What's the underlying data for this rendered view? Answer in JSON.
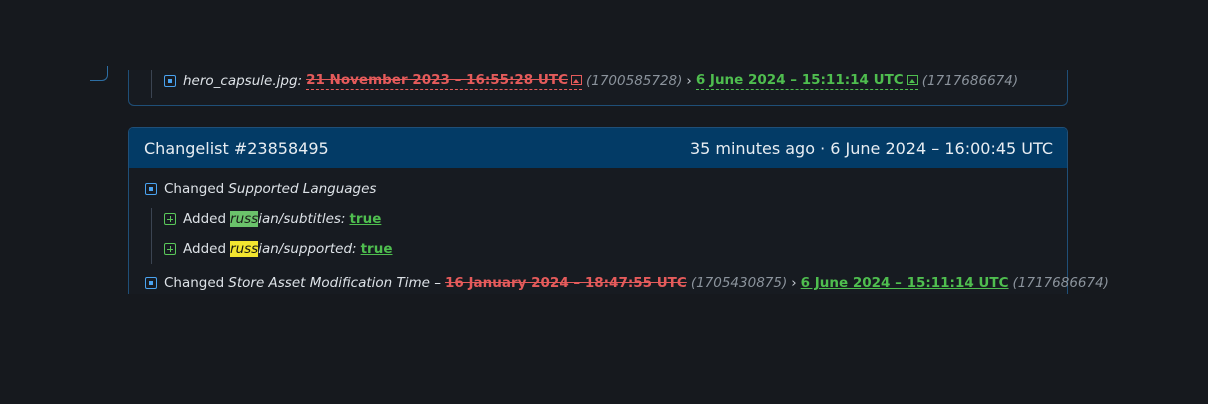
{
  "previous_entry": {
    "file_name": "hero_capsule.jpg:",
    "old_date": "21 November 2023 – 16:55:28 UTC",
    "old_timestamp": "(1700585728)",
    "arrow": "›",
    "new_date": "6 June 2024 – 15:11:14 UTC",
    "new_timestamp": "(1717686674)"
  },
  "changelist": {
    "title": "Changelist #23858495",
    "time": "35 minutes ago · 6 June 2024 – 16:00:45 UTC",
    "changes": [
      {
        "verb": "Changed",
        "field": "Supported Languages",
        "sub_items": [
          {
            "verb": "Added",
            "key_highlight": "russ",
            "key_rest": "ian/subtitles:",
            "highlight_color": "#6bc26b",
            "value": "true"
          },
          {
            "verb": "Added",
            "key_highlight": "russ",
            "key_rest": "ian/supported:",
            "highlight_color": "#f2e530",
            "value": "true"
          }
        ]
      },
      {
        "verb": "Changed",
        "field": "Store Asset Modification Time –",
        "old_date": "16 January 2024 – 18:47:55 UTC",
        "old_timestamp": "(1705430875)",
        "arrow": "›",
        "new_date": "6 June 2024 – 15:11:14 UTC",
        "new_timestamp": "(1717686674)"
      }
    ]
  },
  "colors": {
    "background": "#16191e",
    "header": "#033b66",
    "removed": "#e55b5b",
    "added": "#4fbe4f",
    "accent": "#4aa3f0"
  }
}
